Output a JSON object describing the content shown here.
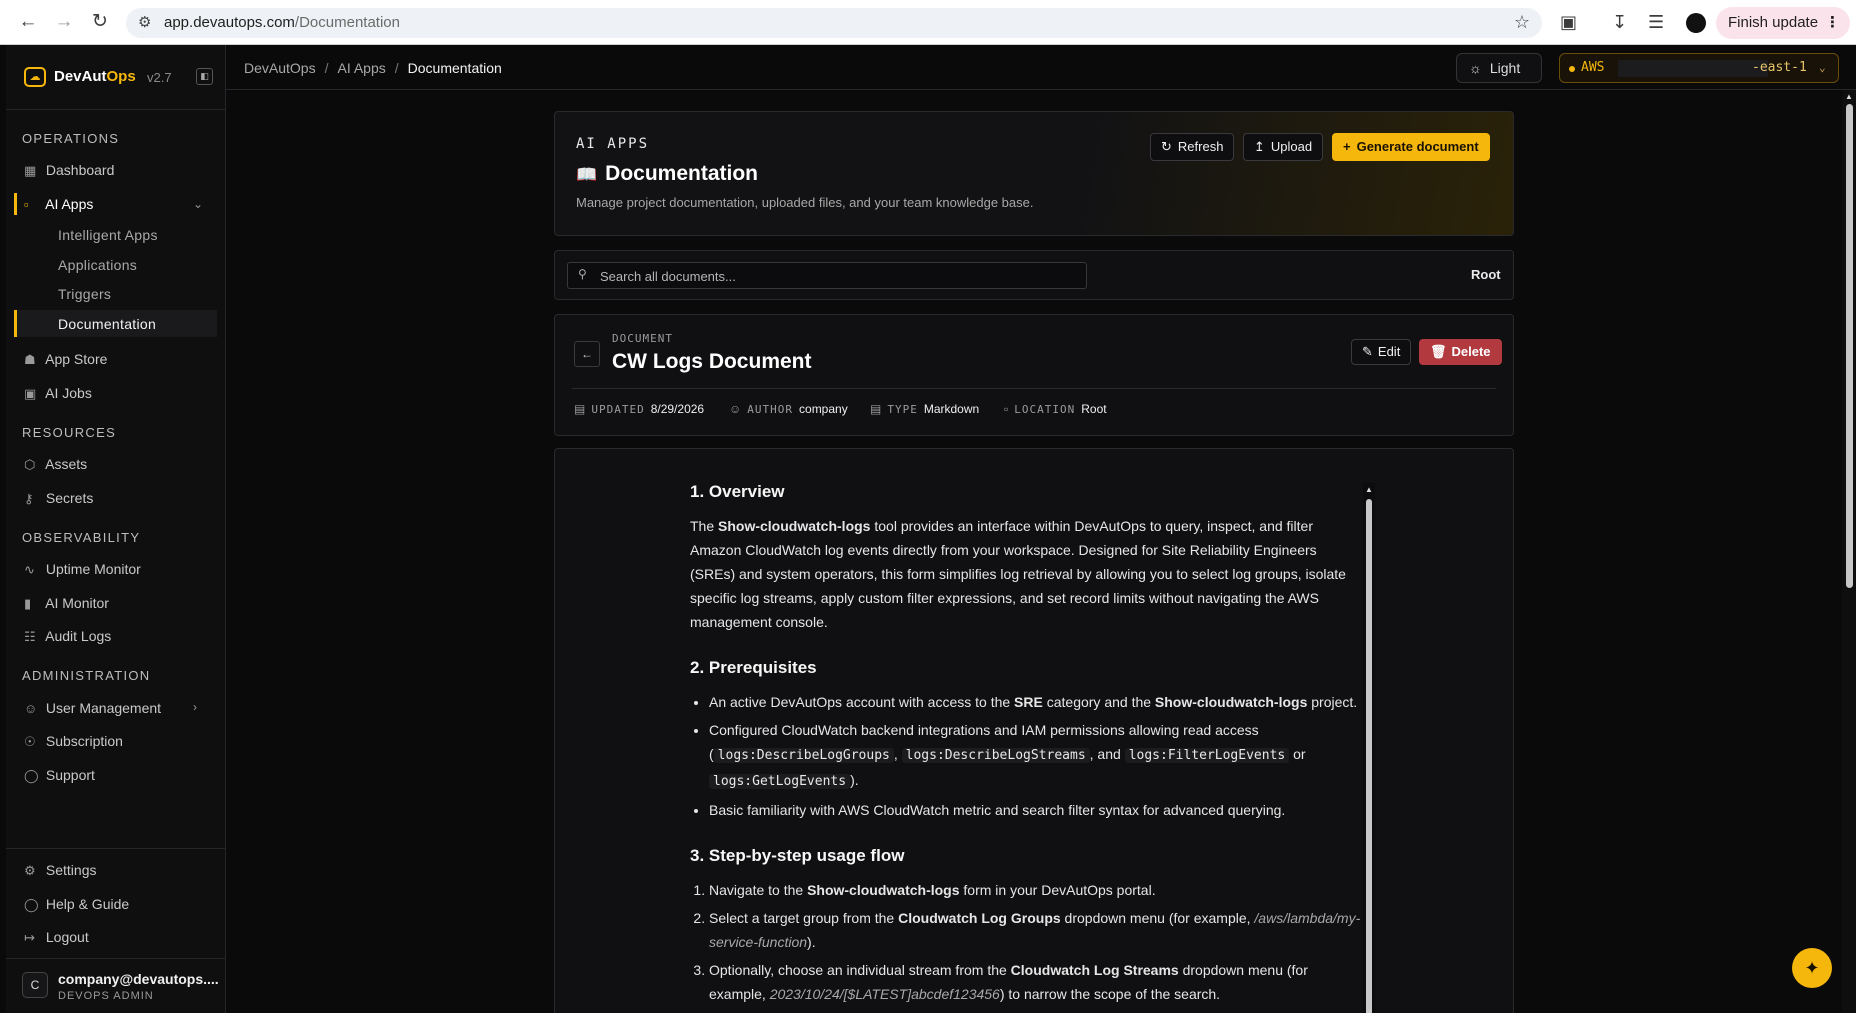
{
  "browser": {
    "url_host": "app.devautops.com",
    "url_path": "/Documentation",
    "finish_update": "Finish update"
  },
  "sidebar": {
    "brand_dev": "DevAut",
    "brand_ops": "Ops",
    "version": "v2.7",
    "sections": {
      "operations": "OPERATIONS",
      "resources": "RESOURCES",
      "observability": "OBSERVABILITY",
      "administration": "ADMINISTRATION"
    },
    "items": {
      "dashboard": "Dashboard",
      "ai_apps": "AI Apps",
      "intelligent_apps": "Intelligent Apps",
      "applications": "Applications",
      "triggers": "Triggers",
      "documentation": "Documentation",
      "app_store": "App Store",
      "ai_jobs": "AI Jobs",
      "assets": "Assets",
      "secrets": "Secrets",
      "uptime_monitor": "Uptime Monitor",
      "ai_monitor": "AI Monitor",
      "audit_logs": "Audit Logs",
      "user_management": "User Management",
      "subscription": "Subscription",
      "support": "Support",
      "settings": "Settings",
      "help_guide": "Help & Guide",
      "logout": "Logout"
    },
    "user": {
      "initial": "C",
      "email": "company@devautops....",
      "role": "DEVOPS ADMIN"
    }
  },
  "topbar": {
    "breadcrumb": [
      "DevAutOps",
      "AI Apps",
      "Documentation"
    ],
    "theme_label": "Light",
    "aws_label": "AWS",
    "aws_region_suffix": "-east-1"
  },
  "hero": {
    "eyebrow": "AI APPS",
    "title": "Documentation",
    "subtitle": "Manage project documentation, uploaded files, and your team knowledge base.",
    "refresh": "Refresh",
    "upload": "Upload",
    "generate": "Generate document"
  },
  "search": {
    "placeholder": "Search all documents...",
    "location": "Root"
  },
  "document": {
    "eyebrow": "DOCUMENT",
    "title": "CW Logs Document",
    "edit": "Edit",
    "delete": "Delete",
    "meta": {
      "updated_label": "UPDATED",
      "updated": "8/29/2026",
      "author_label": "AUTHOR",
      "author": "company",
      "type_label": "TYPE",
      "type": "Markdown",
      "location_label": "LOCATION",
      "location": "Root"
    }
  },
  "content": {
    "h1": "1. Overview",
    "overview": {
      "a": "The ",
      "b": "Show-cloudwatch-logs",
      "c": " tool provides an interface within DevAutOps to query, inspect, and filter Amazon CloudWatch log events directly from your workspace. Designed for Site Reliability Engineers (SREs) and system operators, this form simplifies log retrieval by allowing you to select log groups, isolate specific log streams, apply custom filter expressions, and set record limits without navigating the AWS management console."
    },
    "h2": "2. Prerequisites",
    "pre1": {
      "a": "An active DevAutOps account with access to the ",
      "b": "SRE",
      "c": " category and the ",
      "d": "Show-cloudwatch-logs",
      "e": " project."
    },
    "pre2": {
      "a": "Configured CloudWatch backend integrations and IAM permissions allowing read access (",
      "c1": "logs:DescribeLogGroups",
      "s1": ", ",
      "c2": "logs:DescribeLogStreams",
      "s2": ", and ",
      "c3": "logs:FilterLogEvents",
      "s3": " or ",
      "c4": "logs:GetLogEvents",
      "e": ")."
    },
    "pre3": "Basic familiarity with AWS CloudWatch metric and search filter syntax for advanced querying.",
    "h3": "3. Step-by-step usage flow",
    "step1": {
      "a": "Navigate to the ",
      "b": "Show-cloudwatch-logs",
      "c": " form in your DevAutOps portal."
    },
    "step2": {
      "a": "Select a target group from the ",
      "b": "Cloudwatch Log Groups",
      "c": " dropdown menu (for example, ",
      "d": "/aws/lambda/my-service-function",
      "e": ")."
    },
    "step3": {
      "a": "Optionally, choose an individual stream from the ",
      "b": "Cloudwatch Log Streams",
      "c": " dropdown menu (for example, ",
      "d": "2023/10/24/[$LATEST]abcdef123456",
      "e": ") to narrow the scope of the search."
    }
  }
}
